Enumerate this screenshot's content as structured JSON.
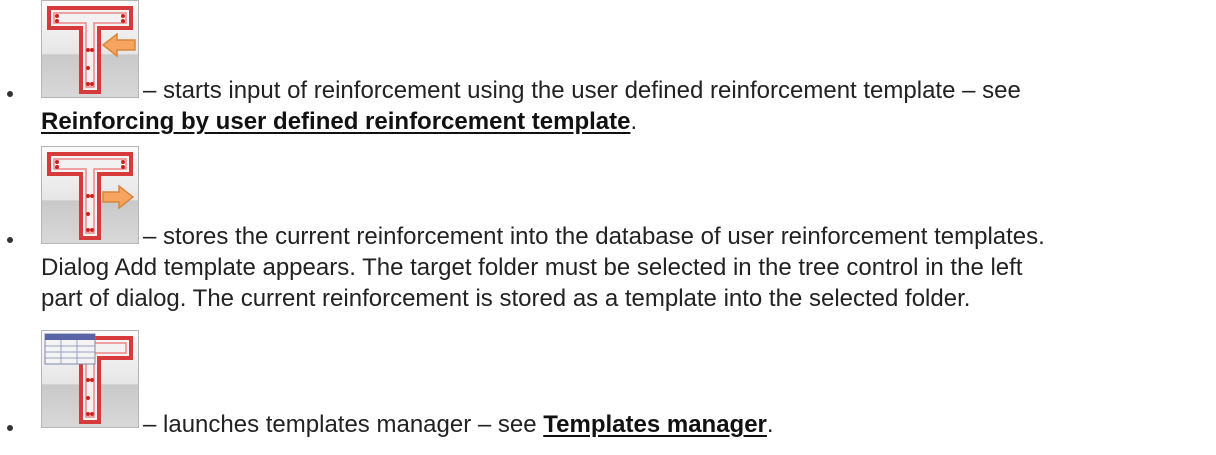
{
  "items": [
    {
      "icon": "t-section-template-input-icon",
      "text_line1": "– starts input of reinforcement using the user defined reinforcement template – see",
      "link": "Reinforcing by user defined reinforcement template",
      "trail": "."
    },
    {
      "icon": "t-section-template-store-icon",
      "text_line1": "– stores the current reinforcement into the database of user reinforcement templates.",
      "text_line2": "Dialog Add template appears. The target folder must be selected in the tree control in the left",
      "text_line3": "part of dialog. The current reinforcement is stored as a template into the selected folder."
    },
    {
      "icon": "t-section-templates-manager-icon",
      "text_prefix": "– launches templates manager – see ",
      "link": "Templates manager",
      "trail": "."
    }
  ]
}
